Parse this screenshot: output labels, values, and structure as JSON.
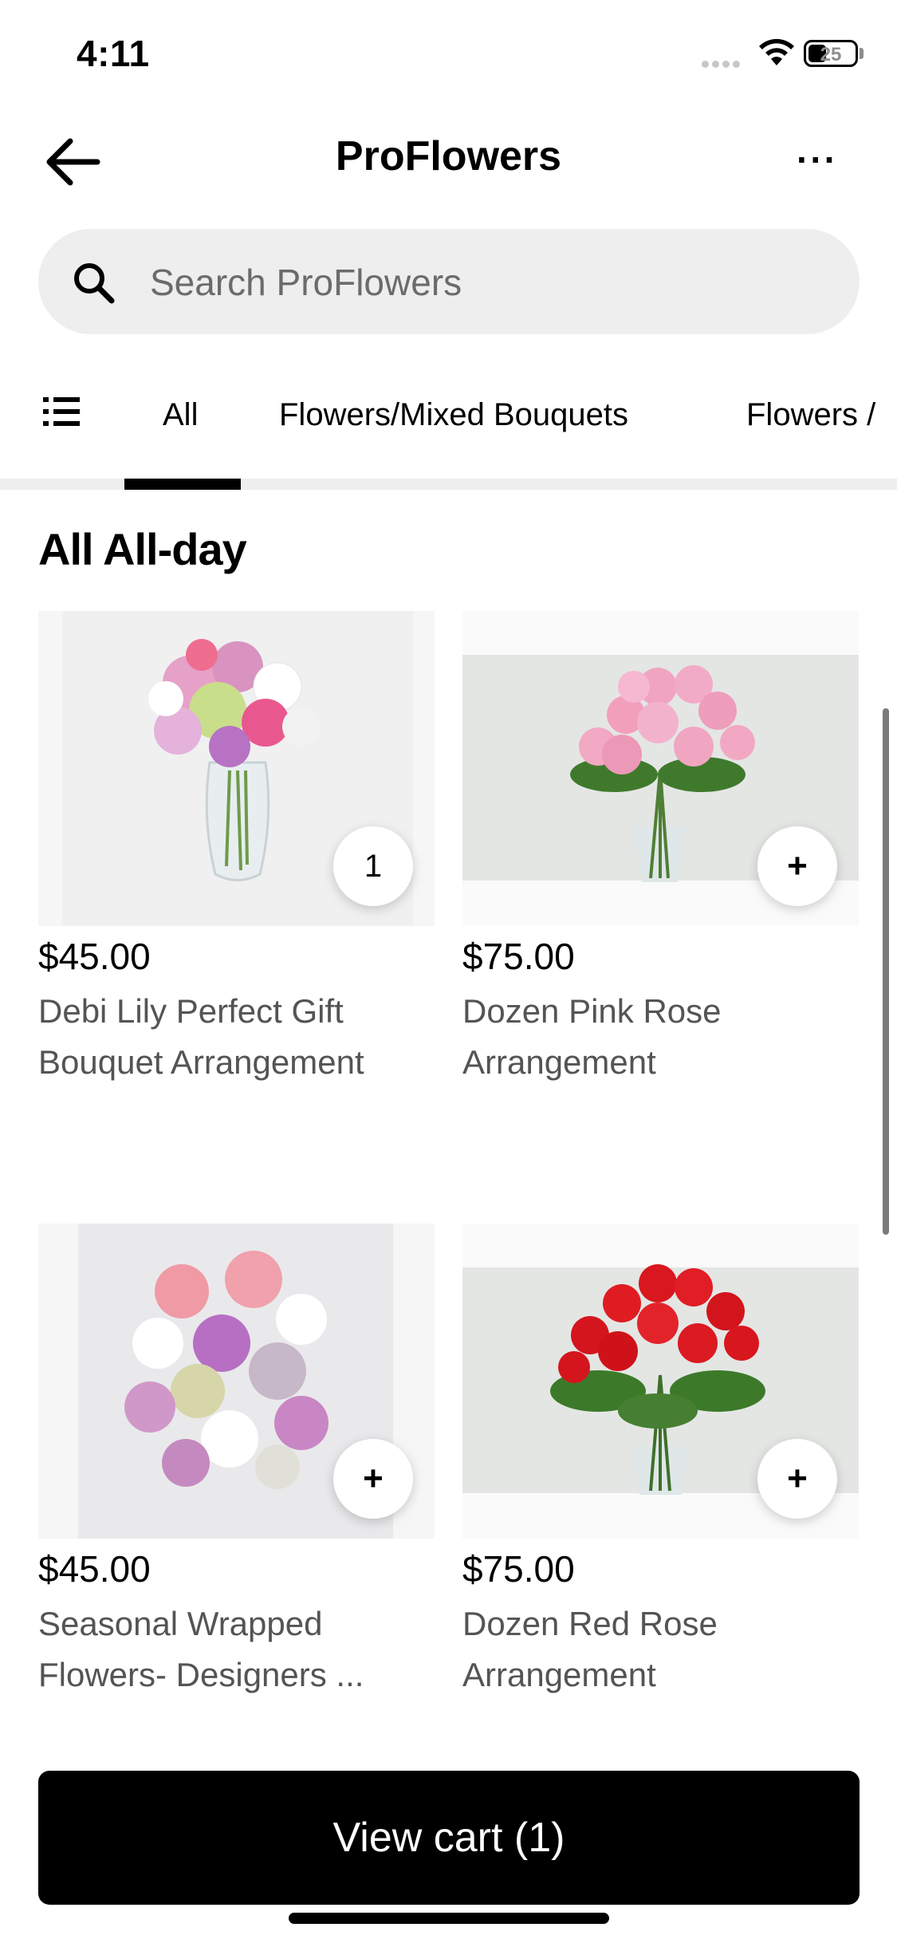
{
  "status_bar": {
    "time": "4:11",
    "battery": "25"
  },
  "header": {
    "title": "ProFlowers",
    "more": "···"
  },
  "search": {
    "placeholder": "Search ProFlowers"
  },
  "tabs": [
    {
      "label": "All"
    },
    {
      "label": "Flowers/Mixed Bouquets"
    },
    {
      "label": "Flowers /"
    }
  ],
  "section": {
    "title": "All All-day"
  },
  "products": [
    {
      "price": "$45.00",
      "name": "Debi Lily Perfect Gift Bouquet Arrangement",
      "quantity": "1"
    },
    {
      "price": "$75.00",
      "name": "Dozen Pink Rose Arrangement",
      "action": "+"
    },
    {
      "price": "$45.00",
      "name": "Seasonal Wrapped Flowers- Designers ...",
      "action": "+"
    },
    {
      "price": "$75.00",
      "name": "Dozen Red Rose Arrangement",
      "action": "+"
    }
  ],
  "cart": {
    "label": "View cart (1)"
  },
  "colors": {
    "accent": "#000000",
    "search_bg": "#eeeeee",
    "text_secondary": "#545454"
  }
}
